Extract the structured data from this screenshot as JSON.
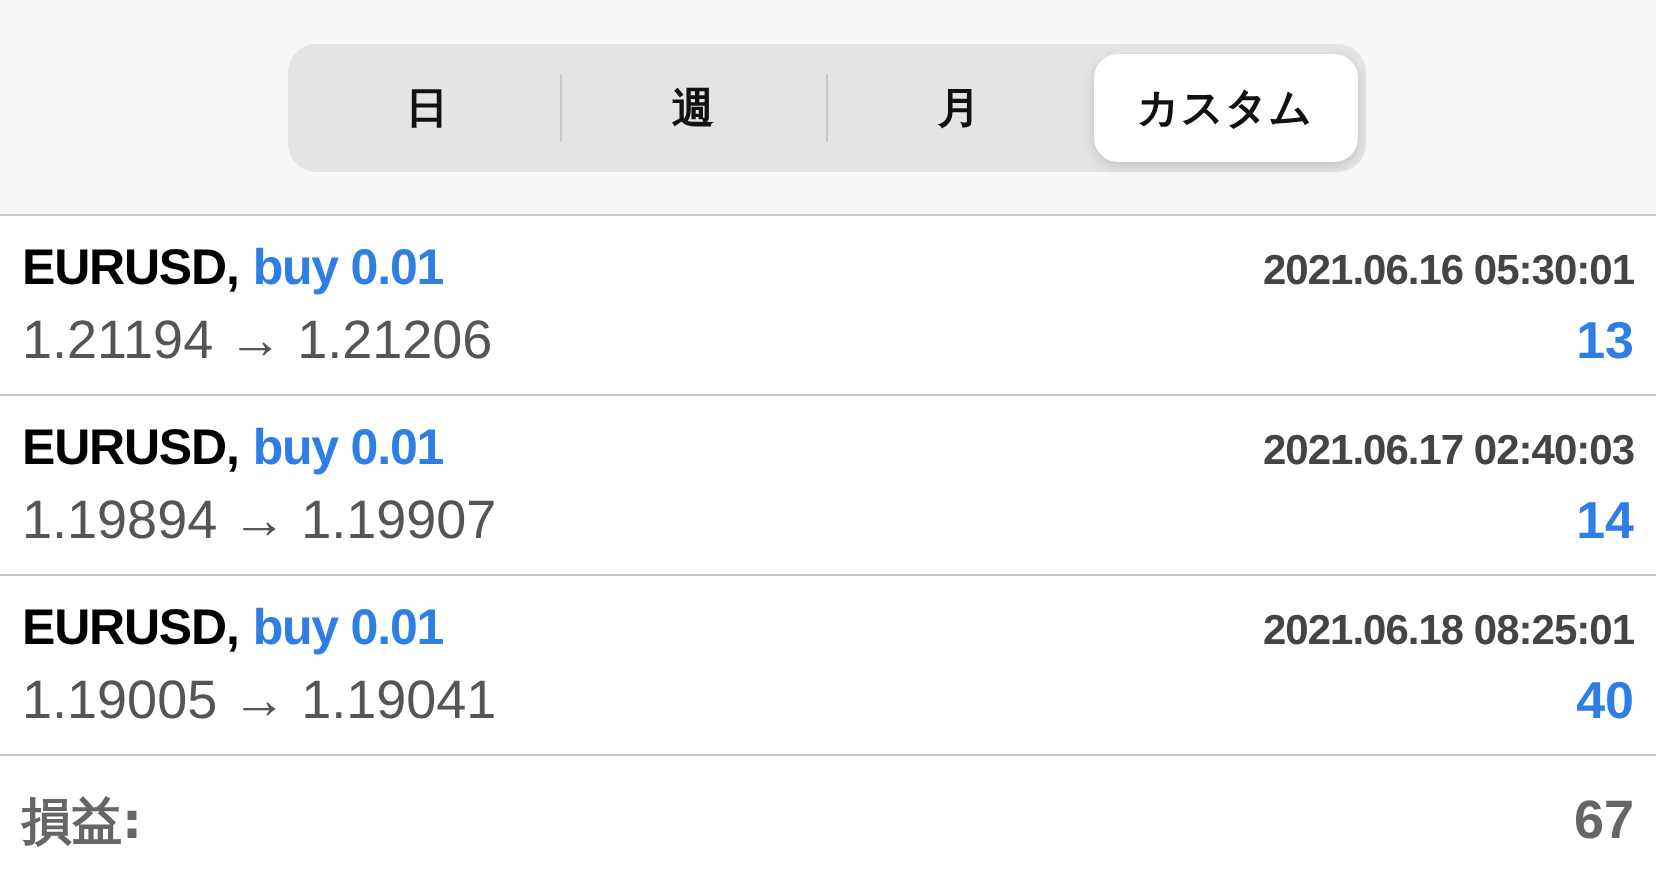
{
  "period_tabs": [
    {
      "label": "日",
      "selected": false
    },
    {
      "label": "週",
      "selected": false
    },
    {
      "label": "月",
      "selected": false
    },
    {
      "label": "カスタム",
      "selected": true
    }
  ],
  "trades": [
    {
      "symbol": "EURUSD,",
      "order": "buy 0.01",
      "time": "2021.06.16 05:30:01",
      "prices": "1.21194 → 1.21206",
      "profit": "13"
    },
    {
      "symbol": "EURUSD,",
      "order": "buy 0.01",
      "time": "2021.06.17 02:40:03",
      "prices": "1.19894 → 1.19907",
      "profit": "14"
    },
    {
      "symbol": "EURUSD,",
      "order": "buy 0.01",
      "time": "2021.06.18 08:25:01",
      "prices": "1.19005 → 1.19041",
      "profit": "40"
    }
  ],
  "summary": {
    "label": "損益:",
    "value": "67"
  }
}
